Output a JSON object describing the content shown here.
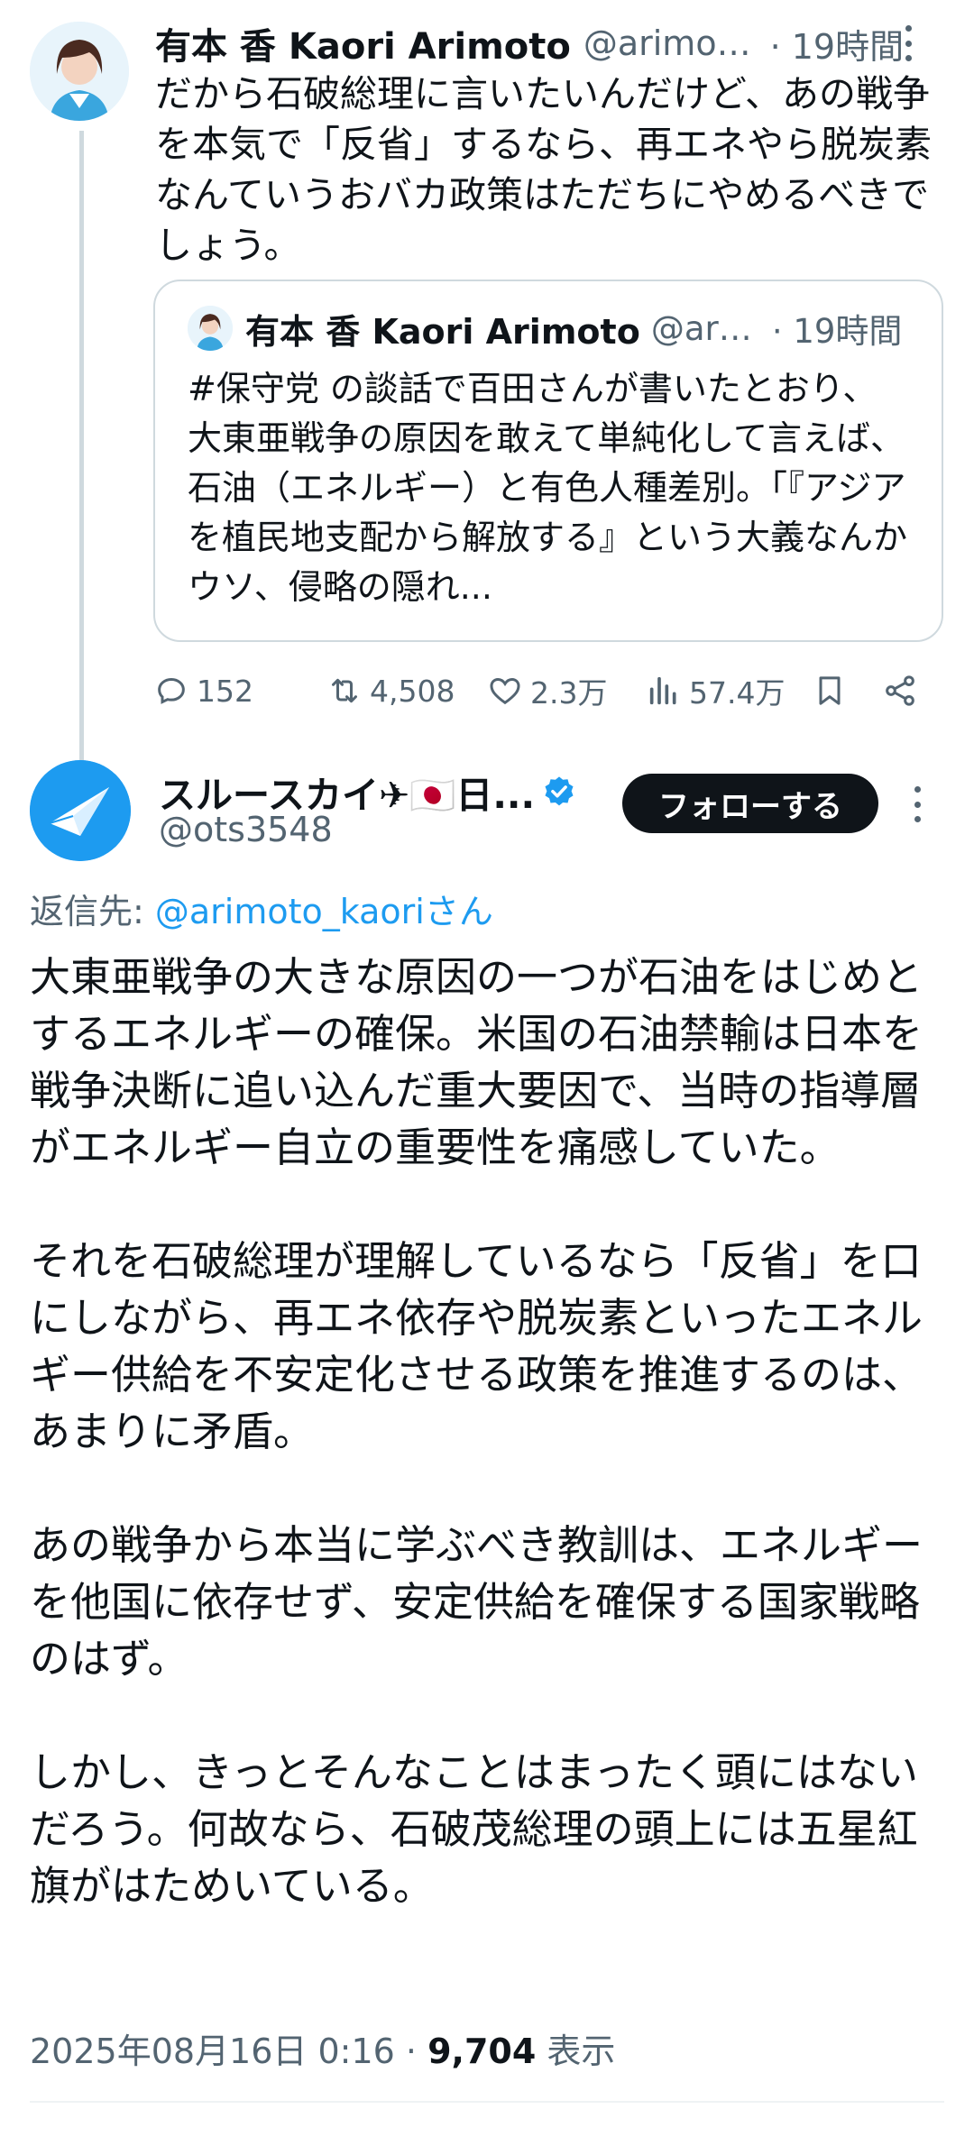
{
  "tweet1": {
    "name": "有本 香 Kaori Arimoto",
    "handle": "@arimot...",
    "time": "· 19時間",
    "text": "だから石破総理に言いたいんだけど、あの戦争を本気で「反省」するなら、再エネやら脱炭素なんていうおバカ政策はただちにやめるべきでしょう。",
    "quote": {
      "name": "有本 香 Kaori Arimoto",
      "handle": "@ari...",
      "time": "· 19時間",
      "text": "#保守党 の談話で百田さんが書いたとおり、大東亜戦争の原因を敢えて単純化して言えば、石油（エネルギー）と有色人種差別。「『アジアを植民地支配から解放する』という大義なんかウソ、侵略の隠れ..."
    },
    "actions": {
      "replies": "152",
      "reposts": "4,508",
      "likes": "2.3万",
      "views": "57.4万"
    }
  },
  "tweet2": {
    "name": "スルースカイ✈🇯🇵日...",
    "handle": "@ots3548",
    "follow_label": "フォローする",
    "reply_prefix": "返信先: ",
    "reply_mention": "@arimoto_kaoriさん",
    "text": "大東亜戦争の大きな原因の一つが石油をはじめとするエネルギーの確保。米国の石油禁輸は日本を戦争決断に追い込んだ重大要因で、当時の指導層がエネルギー自立の重要性を痛感していた。\n\nそれを石破総理が理解しているなら「反省」を口にしながら、再エネ依存や脱炭素といったエネルギー供給を不安定化させる政策を推進するのは、あまりに矛盾。\n\nあの戦争から本当に学ぶべき教訓は、エネルギーを他国に依存せず、安定供給を確保する国家戦略のはず。\n\nしかし、きっとそんなことはまったく頭にはないだろう。何故なら、石破茂総理の頭上には五星紅旗がはためいている。",
    "date": "2025年08月16日 0:16 · ",
    "views_count": "9,704",
    "views_label": " 表示"
  },
  "colors": {
    "accent": "#1d9bf0",
    "text": "#0f1419",
    "secondary": "#536471",
    "border": "#cfd9de"
  }
}
